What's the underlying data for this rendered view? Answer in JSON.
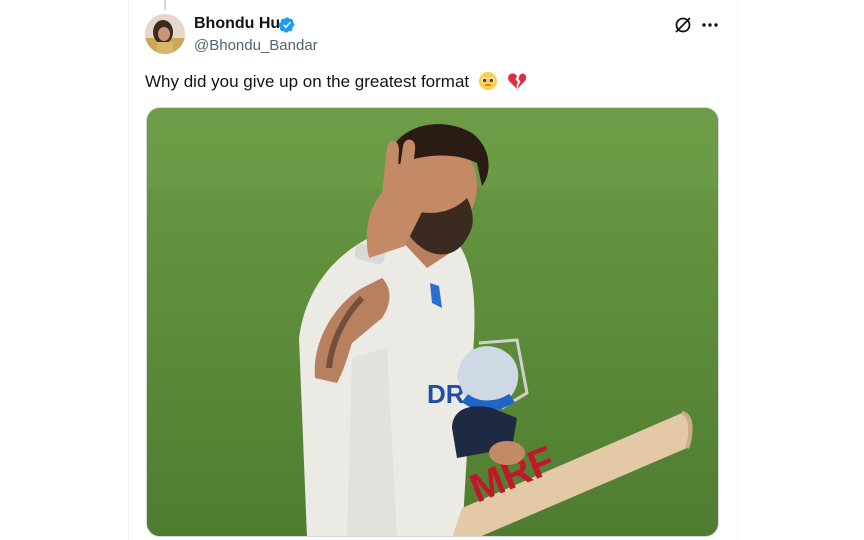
{
  "author": {
    "display_name": "Bhondu Hu",
    "handle": "@Bhondu_Bandar",
    "verified": true,
    "avatar_icon": "profile-avatar"
  },
  "header_actions": {
    "grok_icon": "grok-icon",
    "more_icon": "more-options-icon"
  },
  "tweet": {
    "text": "Why did you give up on the greatest format",
    "emojis": [
      "pleading-face-emoji",
      "broken-heart-emoji"
    ]
  },
  "media": {
    "type": "photo",
    "alt_icon": "cricketer-photo",
    "jersey_text": "DRE",
    "bat_text": "MRF"
  },
  "colors": {
    "verified_blue": "#1d9bf0",
    "text_primary": "#0f1419",
    "text_secondary": "#536471",
    "border": "#cfd9de",
    "pitch_green": "#5f8a3e"
  }
}
